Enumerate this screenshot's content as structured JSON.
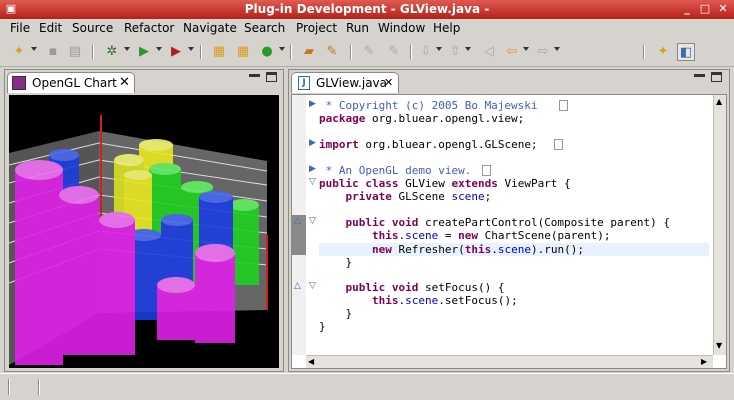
{
  "window": {
    "title": "Plug-in Development - GLView.java -"
  },
  "menu": [
    "File",
    "Edit",
    "Source",
    "Refactor",
    "Navigate",
    "Search",
    "Project",
    "Run",
    "Window",
    "Help"
  ],
  "left_view": {
    "tab_label": "OpenGL Chart"
  },
  "editor": {
    "tab_label": "GLView.java",
    "lines": [
      " * Copyright (c) 2005 Bo Majewski ",
      "package org.bluear.opengl.view;",
      "",
      "import org.bluear.opengl.GLScene;",
      "",
      " * An OpenGL demo view.",
      "public class GLView extends ViewPart {",
      "    private GLScene scene;",
      "",
      "    public void createPartControl(Composite parent) {",
      "        this.scene = new ChartScene(parent);",
      "        new Refresher(this.scene).run();",
      "    }",
      "",
      "    public void setFocus() {",
      "        this.scene.setFocus();",
      "    }",
      "}"
    ]
  },
  "colors": {
    "title_bg": "#c8322b",
    "keyword": "#7f0055",
    "comment": "#3f5fbf",
    "field": "#0000c0",
    "current_line": "#e8f2fe"
  }
}
